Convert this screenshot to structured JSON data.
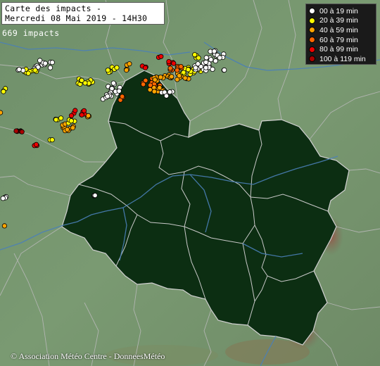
{
  "title": {
    "line1": "Carte des impacts -",
    "line2": "Mercredi 08 Mai 2019 - 14H30"
  },
  "impact_count": "669 impacts",
  "legend": [
    {
      "label": "00 à 19 min",
      "color": "#ffffff"
    },
    {
      "label": "20 à 39 min",
      "color": "#ffff00"
    },
    {
      "label": "40 à 59 min",
      "color": "#ffa500"
    },
    {
      "label": "60 à 79 min",
      "color": "#ff6600"
    },
    {
      "label": "80 à 99 min",
      "color": "#ee0000"
    },
    {
      "label": "100 à 119 min",
      "color": "#aa0000"
    }
  ],
  "copyright": "© Association Météo Centre - DonneesMétéo",
  "colors": {
    "terrain": "#6b8e6b",
    "region_fill": "#0c2e12",
    "borders": "#c8c8c8",
    "rivers": "#4a7fb8",
    "relief": "#a0524a"
  }
}
